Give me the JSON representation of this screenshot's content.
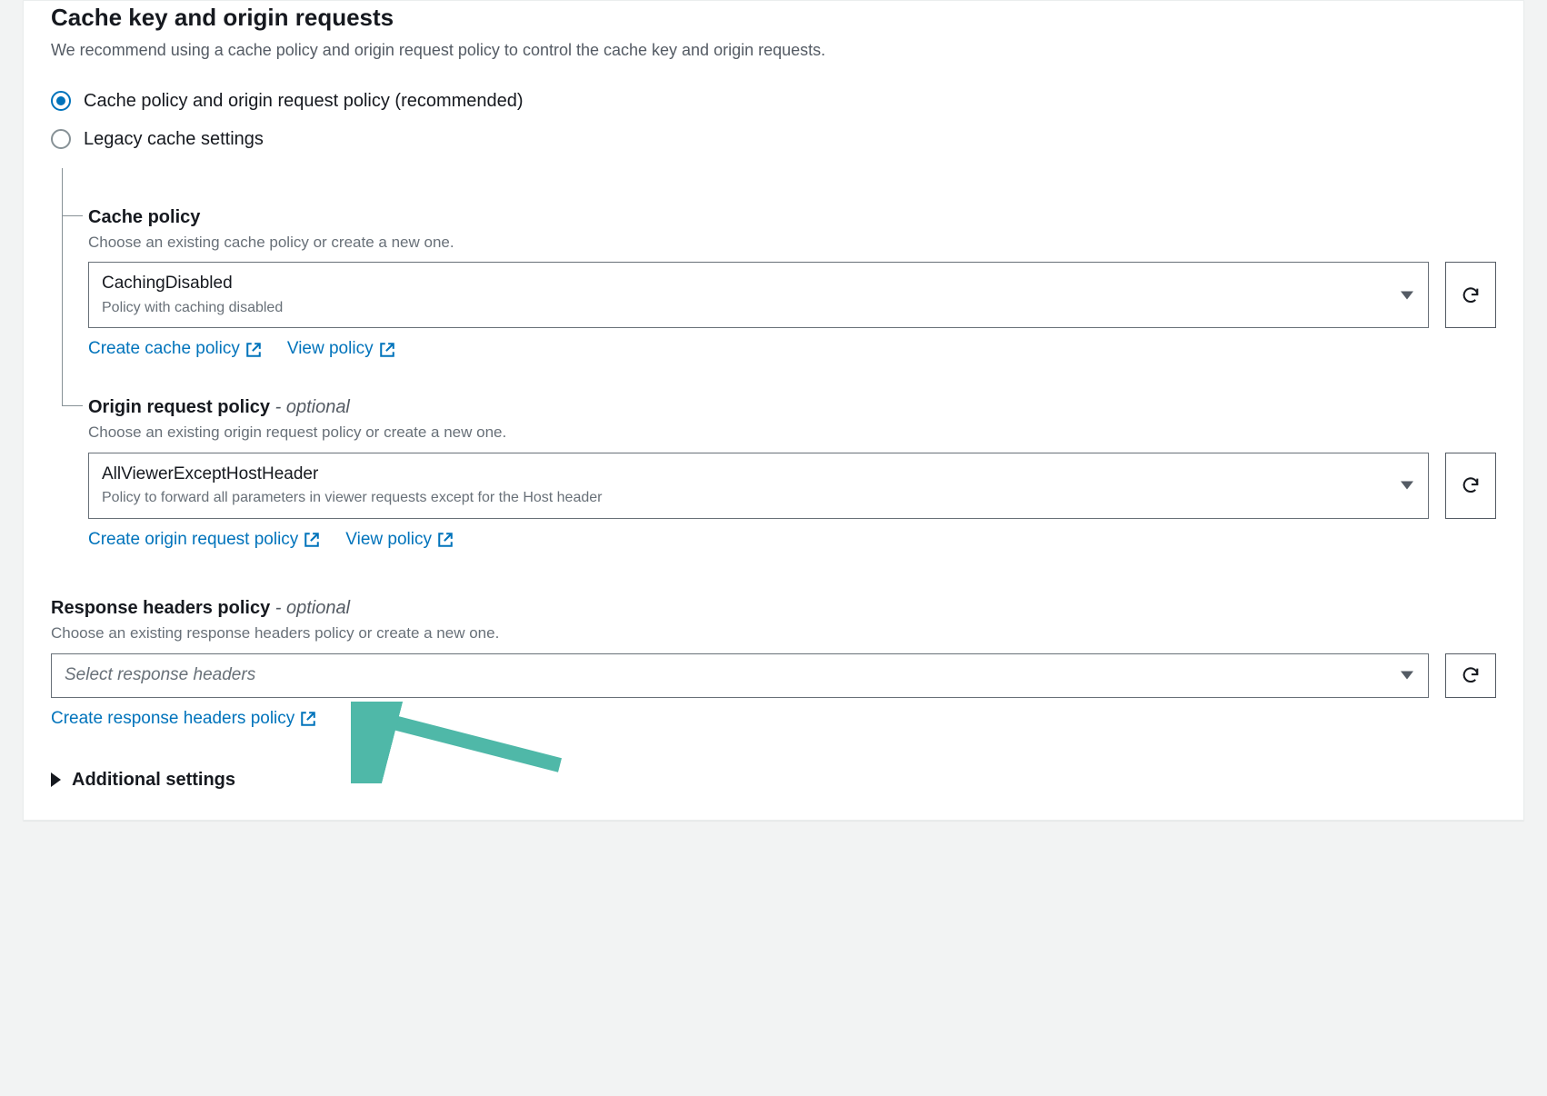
{
  "section": {
    "title": "Cache key and origin requests",
    "description": "We recommend using a cache policy and origin request policy to control the cache key and origin requests."
  },
  "radios": {
    "recommended": "Cache policy and origin request policy (recommended)",
    "legacy": "Legacy cache settings"
  },
  "cache_policy": {
    "label": "Cache policy",
    "desc": "Choose an existing cache policy or create a new one.",
    "selected_value": "CachingDisabled",
    "selected_desc": "Policy with caching disabled",
    "create_link": "Create cache policy",
    "view_link": "View policy"
  },
  "origin_request_policy": {
    "label": "Origin request policy",
    "optional": " - optional",
    "desc": "Choose an existing origin request policy or create a new one.",
    "selected_value": "AllViewerExceptHostHeader",
    "selected_desc": "Policy to forward all parameters in viewer requests except for the Host header",
    "create_link": "Create origin request policy",
    "view_link": "View policy"
  },
  "response_headers_policy": {
    "label": "Response headers policy",
    "optional": " - optional",
    "desc": "Choose an existing response headers policy or create a new one.",
    "placeholder": "Select response headers",
    "create_link": "Create response headers policy"
  },
  "additional_settings": {
    "label": "Additional settings"
  },
  "colors": {
    "link": "#0073bb",
    "arrow": "#4fb8a8"
  }
}
